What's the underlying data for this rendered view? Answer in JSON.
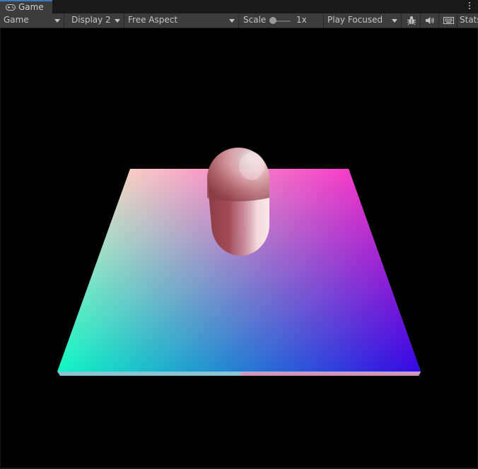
{
  "tab": {
    "label": "Game",
    "icon": "gamepad-icon"
  },
  "toolbar": {
    "view_dropdown": "Game",
    "display_dropdown": "Display 2",
    "aspect_dropdown": "Free Aspect",
    "scale_label": "Scale",
    "scale_value": "1x",
    "scale_level": 0,
    "play_mode_dropdown": "Play Focused",
    "stats_label": "Stats",
    "icons": [
      "bug-icon",
      "speaker-icon",
      "keyboard-icon"
    ]
  },
  "scene": {
    "objects": [
      "gradient-plane",
      "capsule"
    ],
    "plane_colors": {
      "back_left": "#fcfcc4",
      "back_right": "#f40ec8",
      "front_left": "#0cf8c4",
      "front_right": "#3404e4"
    },
    "capsule_color": "#c8828c",
    "background": "#000000"
  }
}
